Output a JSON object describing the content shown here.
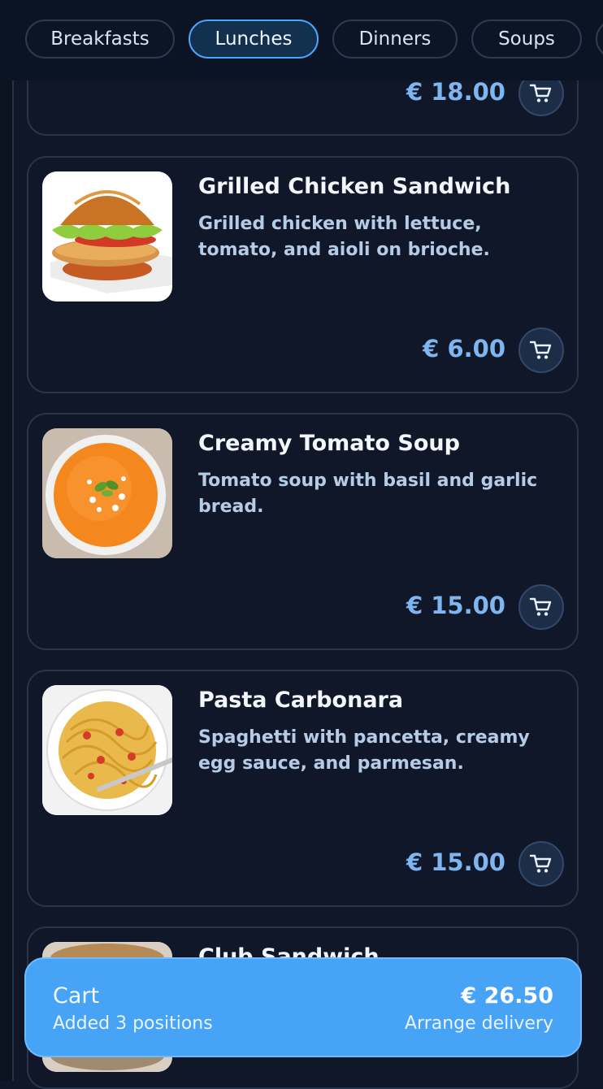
{
  "tabs": [
    {
      "label": "Breakfasts"
    },
    {
      "label": "Lunches"
    },
    {
      "label": "Dinners"
    },
    {
      "label": "Soups"
    }
  ],
  "active_tab": "Lunches",
  "items": [
    {
      "name": "",
      "description": "",
      "price": "€ 18.00"
    },
    {
      "name": "Grilled Chicken Sandwich",
      "description": "Grilled chicken with lettuce, tomato, and aioli on brioche.",
      "price": "€ 6.00"
    },
    {
      "name": "Creamy Tomato Soup",
      "description": "Tomato soup with basil and garlic bread.",
      "price": "€ 15.00"
    },
    {
      "name": "Pasta Carbonara",
      "description": "Spaghetti with pancetta, creamy egg sauce, and parmesan.",
      "price": "€ 15.00"
    },
    {
      "name": "Club Sandwich",
      "description": "",
      "price": ""
    }
  ],
  "cart": {
    "title": "Cart",
    "subtitle": "Added 3 positions",
    "total": "€ 26.50",
    "action": "Arrange delivery"
  },
  "icons": {
    "add_to_cart": "cart-icon"
  },
  "colors": {
    "accent": "#46a3f6",
    "price": "#7fb6f0",
    "background": "#0f1728"
  }
}
